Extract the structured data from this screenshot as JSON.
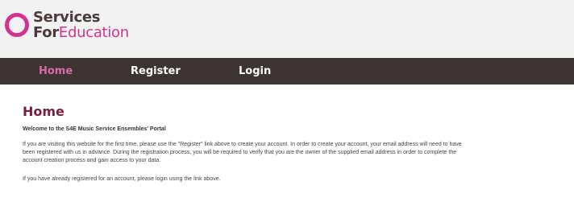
{
  "header": {
    "logo_line1": "Services",
    "logo_for": "For",
    "logo_education": "Education"
  },
  "nav": {
    "items": [
      {
        "label": "Home",
        "active": true
      },
      {
        "label": "Register",
        "active": false
      },
      {
        "label": "Login",
        "active": false
      }
    ]
  },
  "main": {
    "title": "Home",
    "welcome": "Welcome to the S4E Music Service Ensembles' Portal",
    "paragraph1_lines": [
      "If you are visiting this website for the first time, please use the \"Register\" link above to create your account. In order to create your account, your email address will need to have",
      "been registered with us in advance. During the registration process, you will be required to verify that you are the owner of the supplied email address in order to complete the",
      "account creation process and gain access to your data."
    ],
    "paragraph2": "If you have already registered for an account, please login using the link above."
  },
  "colors": {
    "brand_pink": "#d3338f",
    "nav_bg": "#3d3333",
    "title_color": "#7a1e3e"
  }
}
